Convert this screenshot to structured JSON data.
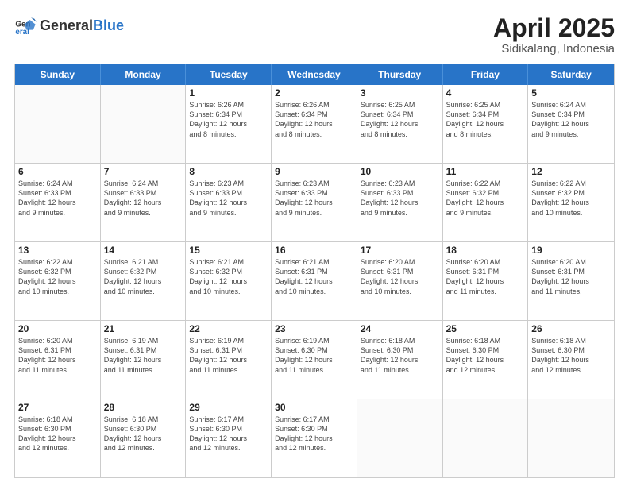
{
  "header": {
    "logo_general": "General",
    "logo_blue": "Blue",
    "month_year": "April 2025",
    "location": "Sidikalang, Indonesia"
  },
  "weekdays": [
    "Sunday",
    "Monday",
    "Tuesday",
    "Wednesday",
    "Thursday",
    "Friday",
    "Saturday"
  ],
  "rows": [
    [
      {
        "day": "",
        "lines": []
      },
      {
        "day": "",
        "lines": []
      },
      {
        "day": "1",
        "lines": [
          "Sunrise: 6:26 AM",
          "Sunset: 6:34 PM",
          "Daylight: 12 hours",
          "and 8 minutes."
        ]
      },
      {
        "day": "2",
        "lines": [
          "Sunrise: 6:26 AM",
          "Sunset: 6:34 PM",
          "Daylight: 12 hours",
          "and 8 minutes."
        ]
      },
      {
        "day": "3",
        "lines": [
          "Sunrise: 6:25 AM",
          "Sunset: 6:34 PM",
          "Daylight: 12 hours",
          "and 8 minutes."
        ]
      },
      {
        "day": "4",
        "lines": [
          "Sunrise: 6:25 AM",
          "Sunset: 6:34 PM",
          "Daylight: 12 hours",
          "and 8 minutes."
        ]
      },
      {
        "day": "5",
        "lines": [
          "Sunrise: 6:24 AM",
          "Sunset: 6:34 PM",
          "Daylight: 12 hours",
          "and 9 minutes."
        ]
      }
    ],
    [
      {
        "day": "6",
        "lines": [
          "Sunrise: 6:24 AM",
          "Sunset: 6:33 PM",
          "Daylight: 12 hours",
          "and 9 minutes."
        ]
      },
      {
        "day": "7",
        "lines": [
          "Sunrise: 6:24 AM",
          "Sunset: 6:33 PM",
          "Daylight: 12 hours",
          "and 9 minutes."
        ]
      },
      {
        "day": "8",
        "lines": [
          "Sunrise: 6:23 AM",
          "Sunset: 6:33 PM",
          "Daylight: 12 hours",
          "and 9 minutes."
        ]
      },
      {
        "day": "9",
        "lines": [
          "Sunrise: 6:23 AM",
          "Sunset: 6:33 PM",
          "Daylight: 12 hours",
          "and 9 minutes."
        ]
      },
      {
        "day": "10",
        "lines": [
          "Sunrise: 6:23 AM",
          "Sunset: 6:33 PM",
          "Daylight: 12 hours",
          "and 9 minutes."
        ]
      },
      {
        "day": "11",
        "lines": [
          "Sunrise: 6:22 AM",
          "Sunset: 6:32 PM",
          "Daylight: 12 hours",
          "and 9 minutes."
        ]
      },
      {
        "day": "12",
        "lines": [
          "Sunrise: 6:22 AM",
          "Sunset: 6:32 PM",
          "Daylight: 12 hours",
          "and 10 minutes."
        ]
      }
    ],
    [
      {
        "day": "13",
        "lines": [
          "Sunrise: 6:22 AM",
          "Sunset: 6:32 PM",
          "Daylight: 12 hours",
          "and 10 minutes."
        ]
      },
      {
        "day": "14",
        "lines": [
          "Sunrise: 6:21 AM",
          "Sunset: 6:32 PM",
          "Daylight: 12 hours",
          "and 10 minutes."
        ]
      },
      {
        "day": "15",
        "lines": [
          "Sunrise: 6:21 AM",
          "Sunset: 6:32 PM",
          "Daylight: 12 hours",
          "and 10 minutes."
        ]
      },
      {
        "day": "16",
        "lines": [
          "Sunrise: 6:21 AM",
          "Sunset: 6:31 PM",
          "Daylight: 12 hours",
          "and 10 minutes."
        ]
      },
      {
        "day": "17",
        "lines": [
          "Sunrise: 6:20 AM",
          "Sunset: 6:31 PM",
          "Daylight: 12 hours",
          "and 10 minutes."
        ]
      },
      {
        "day": "18",
        "lines": [
          "Sunrise: 6:20 AM",
          "Sunset: 6:31 PM",
          "Daylight: 12 hours",
          "and 11 minutes."
        ]
      },
      {
        "day": "19",
        "lines": [
          "Sunrise: 6:20 AM",
          "Sunset: 6:31 PM",
          "Daylight: 12 hours",
          "and 11 minutes."
        ]
      }
    ],
    [
      {
        "day": "20",
        "lines": [
          "Sunrise: 6:20 AM",
          "Sunset: 6:31 PM",
          "Daylight: 12 hours",
          "and 11 minutes."
        ]
      },
      {
        "day": "21",
        "lines": [
          "Sunrise: 6:19 AM",
          "Sunset: 6:31 PM",
          "Daylight: 12 hours",
          "and 11 minutes."
        ]
      },
      {
        "day": "22",
        "lines": [
          "Sunrise: 6:19 AM",
          "Sunset: 6:31 PM",
          "Daylight: 12 hours",
          "and 11 minutes."
        ]
      },
      {
        "day": "23",
        "lines": [
          "Sunrise: 6:19 AM",
          "Sunset: 6:30 PM",
          "Daylight: 12 hours",
          "and 11 minutes."
        ]
      },
      {
        "day": "24",
        "lines": [
          "Sunrise: 6:18 AM",
          "Sunset: 6:30 PM",
          "Daylight: 12 hours",
          "and 11 minutes."
        ]
      },
      {
        "day": "25",
        "lines": [
          "Sunrise: 6:18 AM",
          "Sunset: 6:30 PM",
          "Daylight: 12 hours",
          "and 12 minutes."
        ]
      },
      {
        "day": "26",
        "lines": [
          "Sunrise: 6:18 AM",
          "Sunset: 6:30 PM",
          "Daylight: 12 hours",
          "and 12 minutes."
        ]
      }
    ],
    [
      {
        "day": "27",
        "lines": [
          "Sunrise: 6:18 AM",
          "Sunset: 6:30 PM",
          "Daylight: 12 hours",
          "and 12 minutes."
        ]
      },
      {
        "day": "28",
        "lines": [
          "Sunrise: 6:18 AM",
          "Sunset: 6:30 PM",
          "Daylight: 12 hours",
          "and 12 minutes."
        ]
      },
      {
        "day": "29",
        "lines": [
          "Sunrise: 6:17 AM",
          "Sunset: 6:30 PM",
          "Daylight: 12 hours",
          "and 12 minutes."
        ]
      },
      {
        "day": "30",
        "lines": [
          "Sunrise: 6:17 AM",
          "Sunset: 6:30 PM",
          "Daylight: 12 hours",
          "and 12 minutes."
        ]
      },
      {
        "day": "",
        "lines": []
      },
      {
        "day": "",
        "lines": []
      },
      {
        "day": "",
        "lines": []
      }
    ]
  ]
}
